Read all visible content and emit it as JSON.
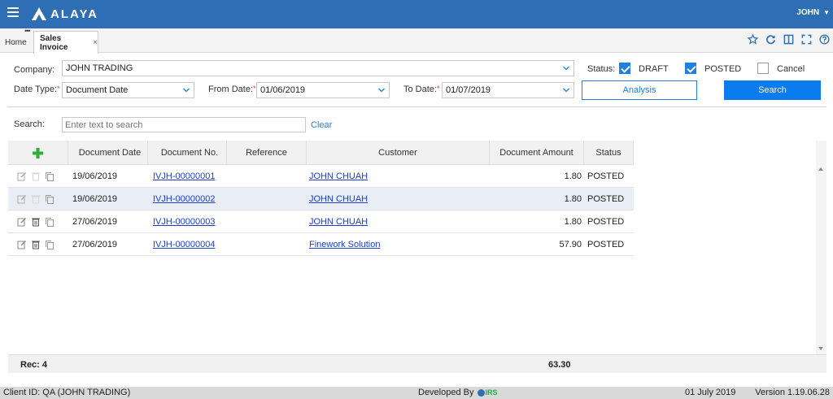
{
  "app": {
    "logo": "ALAYA",
    "user": "JOHN"
  },
  "tabs": {
    "home": "Home",
    "active": "Sales Invoice",
    "close": "×"
  },
  "form": {
    "company_label": "Company:",
    "company_value": "JOHN TRADING",
    "status_label": "Status:",
    "status_options": [
      {
        "label": "DRAFT",
        "checked": true
      },
      {
        "label": "POSTED",
        "checked": true
      },
      {
        "label": "Cancel",
        "checked": false
      }
    ],
    "date_type_label": "Date Type:",
    "date_type_value": "Document Date",
    "from_date_label": "From Date:",
    "from_date_value": "01/06/2019",
    "to_date_label": "To Date:",
    "to_date_value": "01/07/2019",
    "required_mark": "*",
    "analysis_button": "Analysis",
    "search_button": "Search"
  },
  "search": {
    "label": "Search:",
    "placeholder": "Enter text to search",
    "clear": "Clear"
  },
  "grid": {
    "add_icon": "plus-icon",
    "columns": [
      "Document Date",
      "Document No.",
      "Reference",
      "Customer",
      "Document Amount",
      "Status"
    ],
    "rows": [
      {
        "date": "19/06/2019",
        "doc_no": "IVJH-00000001",
        "reference": "",
        "customer": "JOHN CHUAH",
        "amount": "1.80",
        "status": "POSTED"
      },
      {
        "date": "19/06/2019",
        "doc_no": "IVJH-00000002",
        "reference": "",
        "customer": "JOHN CHUAH",
        "amount": "1.80",
        "status": "POSTED"
      },
      {
        "date": "27/06/2019",
        "doc_no": "IVJH-00000003",
        "reference": "",
        "customer": "JOHN CHUAH",
        "amount": "1.80",
        "status": "POSTED"
      },
      {
        "date": "27/06/2019",
        "doc_no": "IVJH-00000004",
        "reference": "",
        "customer": "Finework Solution",
        "amount": "57.90",
        "status": "POSTED"
      }
    ],
    "footer_rec": "Rec: 4",
    "footer_total": "63.30"
  },
  "statusbar": {
    "client": "Client ID: QA (JOHN TRADING)",
    "developed_by": "Developed By",
    "developer_logo": "IRS",
    "date": "01 July 2019",
    "version": "Version 1.19.06.28"
  },
  "colors": {
    "header": "#2d6eb4",
    "accent": "#1e80e3",
    "primary_button": "#0b7bf0",
    "link": "#1e3fcc"
  }
}
